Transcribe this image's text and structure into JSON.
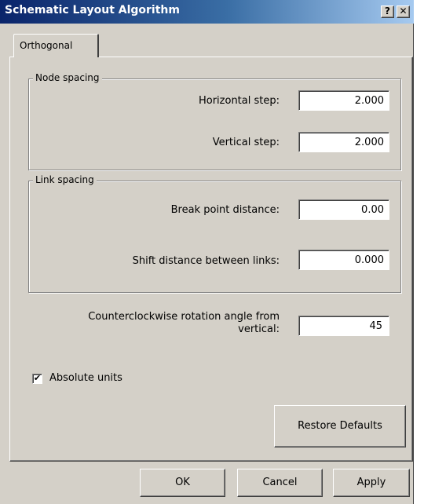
{
  "window": {
    "title": "Schematic Layout Algorithm",
    "help_button": "?",
    "close_button": "✕"
  },
  "tabs": [
    {
      "label": "Orthogonal",
      "active": true
    }
  ],
  "node_spacing": {
    "legend": "Node spacing",
    "horizontal_label": "Horizontal step:",
    "horizontal_value": "2.000",
    "vertical_label": "Vertical step:",
    "vertical_value": "2.000"
  },
  "link_spacing": {
    "legend": "Link spacing",
    "break_label": "Break point distance:",
    "break_value": "0.00",
    "shift_label": "Shift distance between links:",
    "shift_value": "0.000"
  },
  "rotation": {
    "label_line1": "Counterclockwise rotation angle from",
    "label_line2": "vertical:",
    "value": "45"
  },
  "absolute_units": {
    "label": "Absolute units",
    "checked": true,
    "check_glyph": "✔"
  },
  "buttons": {
    "restore_defaults": "Restore Defaults",
    "ok": "OK",
    "cancel": "Cancel",
    "apply": "Apply"
  }
}
